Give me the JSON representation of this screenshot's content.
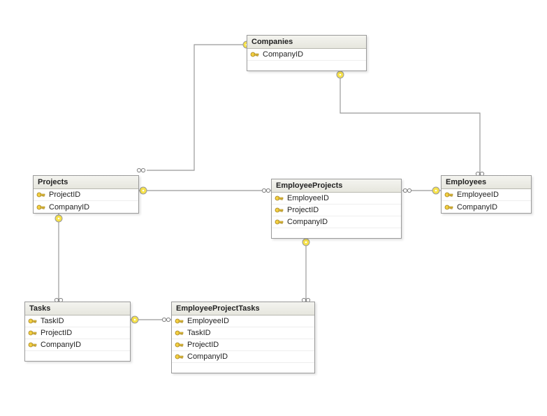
{
  "tables": {
    "companies": {
      "title": "Companies",
      "cols": [
        {
          "name": "CompanyID",
          "pk": true
        }
      ]
    },
    "projects": {
      "title": "Projects",
      "cols": [
        {
          "name": "ProjectID",
          "pk": true
        },
        {
          "name": "CompanyID",
          "pk": true
        }
      ]
    },
    "employees": {
      "title": "Employees",
      "cols": [
        {
          "name": "EmployeeID",
          "pk": true
        },
        {
          "name": "CompanyID",
          "pk": true
        }
      ]
    },
    "employeeprojects": {
      "title": "EmployeeProjects",
      "cols": [
        {
          "name": "EmployeeID",
          "pk": true
        },
        {
          "name": "ProjectID",
          "pk": true
        },
        {
          "name": "CompanyID",
          "pk": true
        }
      ]
    },
    "tasks": {
      "title": "Tasks",
      "cols": [
        {
          "name": "TaskID",
          "pk": true
        },
        {
          "name": "ProjectID",
          "pk": true
        },
        {
          "name": "CompanyID",
          "pk": true
        }
      ]
    },
    "employeeprojecttasks": {
      "title": "EmployeeProjectTasks",
      "cols": [
        {
          "name": "EmployeeID",
          "pk": true
        },
        {
          "name": "TaskID",
          "pk": true
        },
        {
          "name": "ProjectID",
          "pk": true
        },
        {
          "name": "CompanyID",
          "pk": true
        }
      ]
    }
  }
}
